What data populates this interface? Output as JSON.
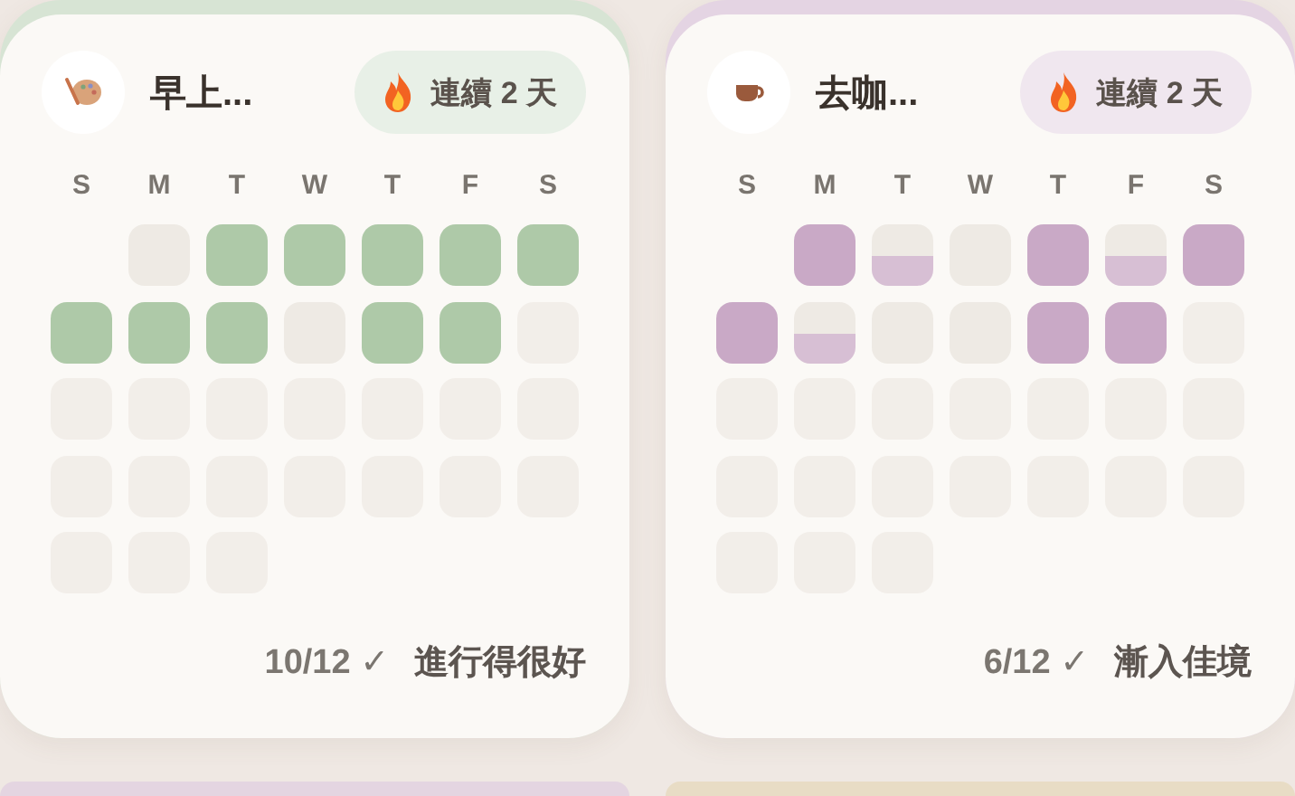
{
  "cards": [
    {
      "color": "#aec9a8",
      "title": "早上...",
      "streak": "連續 2 天",
      "weekdays": [
        "S",
        "M",
        "T",
        "W",
        "T",
        "F",
        "S"
      ],
      "cells": [
        {
          "kind": "blank"
        },
        {
          "kind": "missed"
        },
        {
          "kind": "done"
        },
        {
          "kind": "done"
        },
        {
          "kind": "done"
        },
        {
          "kind": "done"
        },
        {
          "kind": "done"
        },
        {
          "kind": "done"
        },
        {
          "kind": "done"
        },
        {
          "kind": "done"
        },
        {
          "kind": "missed"
        },
        {
          "kind": "done"
        },
        {
          "kind": "done"
        },
        {
          "kind": "future"
        },
        {
          "kind": "future"
        },
        {
          "kind": "future"
        },
        {
          "kind": "future"
        },
        {
          "kind": "future"
        },
        {
          "kind": "future"
        },
        {
          "kind": "future"
        },
        {
          "kind": "future"
        },
        {
          "kind": "future"
        },
        {
          "kind": "future"
        },
        {
          "kind": "future"
        },
        {
          "kind": "future"
        },
        {
          "kind": "future"
        },
        {
          "kind": "future"
        },
        {
          "kind": "future"
        },
        {
          "kind": "future"
        },
        {
          "kind": "future"
        },
        {
          "kind": "future"
        }
      ],
      "score": "10/12 ✓",
      "message": "進行得很好"
    },
    {
      "color": "#c9a9c6",
      "title": "去咖...",
      "streak": "連續 2 天",
      "weekdays": [
        "S",
        "M",
        "T",
        "W",
        "T",
        "F",
        "S"
      ],
      "cells": [
        {
          "kind": "blank"
        },
        {
          "kind": "done"
        },
        {
          "kind": "partial"
        },
        {
          "kind": "missed"
        },
        {
          "kind": "done"
        },
        {
          "kind": "partial"
        },
        {
          "kind": "done"
        },
        {
          "kind": "done"
        },
        {
          "kind": "partial"
        },
        {
          "kind": "missed"
        },
        {
          "kind": "missed"
        },
        {
          "kind": "done"
        },
        {
          "kind": "done"
        },
        {
          "kind": "future"
        },
        {
          "kind": "future"
        },
        {
          "kind": "future"
        },
        {
          "kind": "future"
        },
        {
          "kind": "future"
        },
        {
          "kind": "future"
        },
        {
          "kind": "future"
        },
        {
          "kind": "future"
        },
        {
          "kind": "future"
        },
        {
          "kind": "future"
        },
        {
          "kind": "future"
        },
        {
          "kind": "future"
        },
        {
          "kind": "future"
        },
        {
          "kind": "future"
        },
        {
          "kind": "future"
        },
        {
          "kind": "future"
        },
        {
          "kind": "future"
        },
        {
          "kind": "future"
        }
      ],
      "score": "6/12 ✓",
      "message": "漸入佳境"
    }
  ],
  "peek_cards": [
    {
      "color": "#e4d5e1"
    },
    {
      "color": "#e8dcc5"
    }
  ]
}
